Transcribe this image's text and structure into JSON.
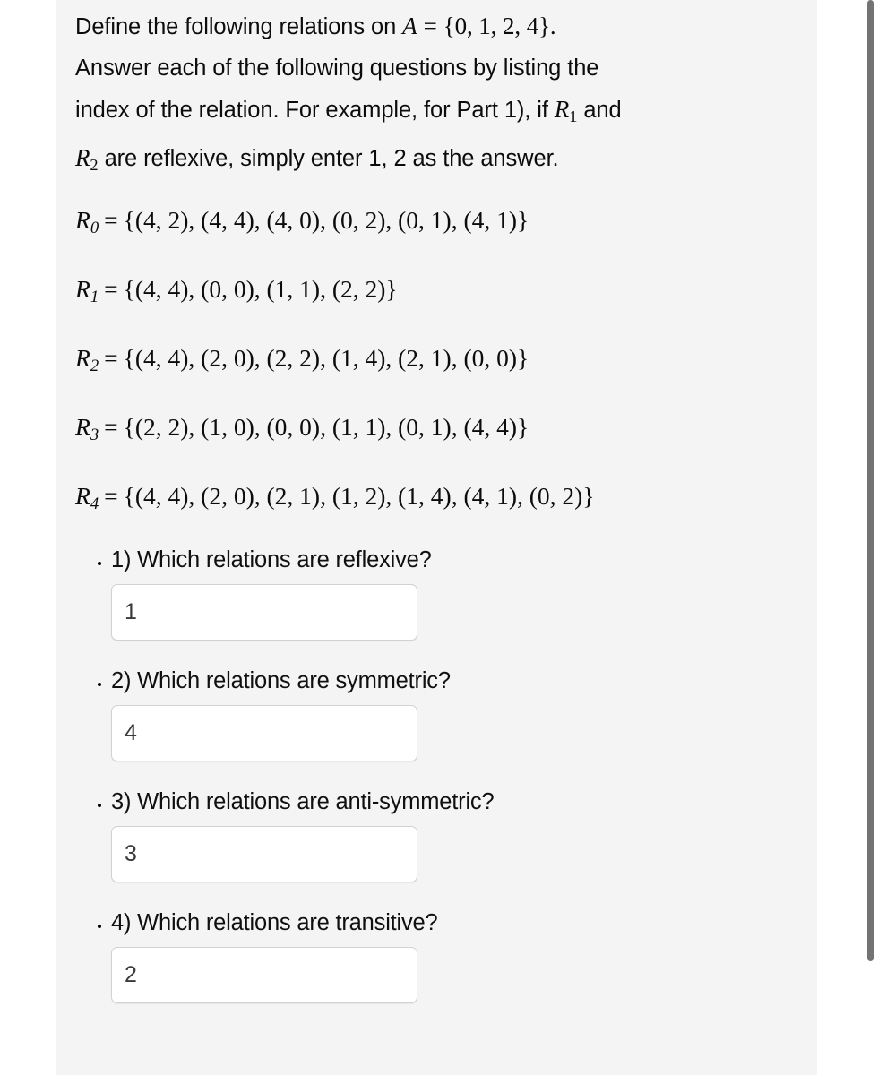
{
  "intro": {
    "line1_a": "Define the following relations on ",
    "line1_math_var": "A",
    "line1_math_eq": "=",
    "line1_math_set": "{0, 1, 2, 4}.",
    "line2": "Answer each of the following questions by listing the",
    "line3_a": "index of the relation. For example, for Part 1), if ",
    "line3_math_var": "R",
    "line3_math_sub": "1",
    "line3_b": " and",
    "line4_math_var": "R",
    "line4_math_sub": "2",
    "line4_b": " are reflexive, simply enter 1, 2 as the answer."
  },
  "relations": [
    {
      "name": "R",
      "subscript": "0",
      "equals": "=",
      "set": "{(4, 2), (4, 4), (4, 0), (0, 2), (0, 1), (4, 1)}",
      "pairs": [
        [
          4,
          2
        ],
        [
          4,
          4
        ],
        [
          4,
          0
        ],
        [
          0,
          2
        ],
        [
          0,
          1
        ],
        [
          4,
          1
        ]
      ]
    },
    {
      "name": "R",
      "subscript": "1",
      "equals": "=",
      "set": "{(4, 4), (0, 0), (1, 1), (2, 2)}",
      "pairs": [
        [
          4,
          4
        ],
        [
          0,
          0
        ],
        [
          1,
          1
        ],
        [
          2,
          2
        ]
      ]
    },
    {
      "name": "R",
      "subscript": "2",
      "equals": "=",
      "set": "{(4, 4), (2, 0), (2, 2), (1, 4), (2, 1), (0, 0)}",
      "pairs": [
        [
          4,
          4
        ],
        [
          2,
          0
        ],
        [
          2,
          2
        ],
        [
          1,
          4
        ],
        [
          2,
          1
        ],
        [
          0,
          0
        ]
      ]
    },
    {
      "name": "R",
      "subscript": "3",
      "equals": "=",
      "set": "{(2, 2), (1, 0), (0, 0), (1, 1), (0, 1), (4, 4)}",
      "pairs": [
        [
          2,
          2
        ],
        [
          1,
          0
        ],
        [
          0,
          0
        ],
        [
          1,
          1
        ],
        [
          0,
          1
        ],
        [
          4,
          4
        ]
      ]
    },
    {
      "name": "R",
      "subscript": "4",
      "equals": "=",
      "set": "{(4, 4), (2, 0), (2, 1), (1, 2), (1, 4), (4, 1), (0, 2)}",
      "pairs": [
        [
          4,
          4
        ],
        [
          2,
          0
        ],
        [
          2,
          1
        ],
        [
          1,
          2
        ],
        [
          1,
          4
        ],
        [
          4,
          1
        ],
        [
          0,
          2
        ]
      ]
    }
  ],
  "universe": {
    "name": "A",
    "elements": [
      0,
      1,
      2,
      4
    ]
  },
  "questions": [
    {
      "label": "1) Which relations are reflexive?",
      "answer": "1",
      "placeholder": ""
    },
    {
      "label": "2) Which relations are symmetric?",
      "answer": "4",
      "placeholder": ""
    },
    {
      "label": "3) Which relations are anti-symmetric?",
      "answer": "3",
      "placeholder": ""
    },
    {
      "label": "4) Which relations are transitive?",
      "answer": "2",
      "placeholder": ""
    }
  ],
  "colors": {
    "panel_background": "#f4f4f4",
    "page_background": "#ffffff",
    "text": "#0c0c0c",
    "input_border": "#d2d2d2",
    "input_background": "#ffffff",
    "answer_text": "#3a3a3a",
    "scrollbar_thumb": "#737373"
  }
}
